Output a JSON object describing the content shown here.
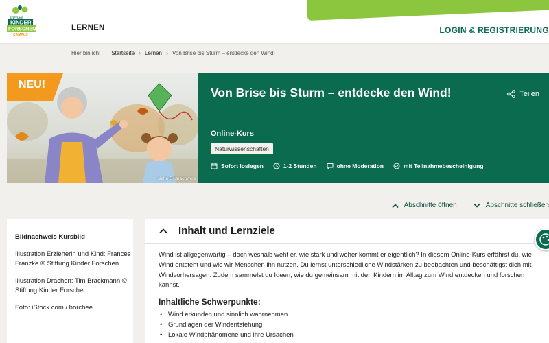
{
  "header": {
    "logo_lines": [
      "STIFTUNG",
      "KINDER",
      "FORSCHEN",
      "CAMPUS"
    ],
    "nav_label": "LERNEN",
    "login_label": "LOGIN & REGISTRIERUNG"
  },
  "breadcrumb": {
    "here": "Hier bin ich:",
    "items": [
      "Startseite",
      "Lernen",
      "Von Brise bis Sturm – entdecke den Wind!"
    ]
  },
  "hero": {
    "badge": "NEU!",
    "title": "Von Brise bis Sturm – entdecke den Wind!",
    "share_label": "Teilen",
    "type": "Online-Kurs",
    "tag": "Naturwissenschaften",
    "meta": [
      {
        "icon": "calendar-icon",
        "label": "Sofort loslegen"
      },
      {
        "icon": "clock-icon",
        "label": "1-2 Stunden"
      },
      {
        "icon": "speech-bubble-icon",
        "label": "ohne Moderation"
      },
      {
        "icon": "certificate-icon",
        "label": "mit Teilnahmebescheinigung"
      }
    ],
    "image_credit_link": "siehe Bildnachweis"
  },
  "toggles": {
    "open_label": "Abschnitte öffnen",
    "close_label": "Abschnitte schließen"
  },
  "sidebar": {
    "title": "Bildnachweis Kursbild",
    "paragraphs": [
      "Illustration Erzieherin und Kind: Frances Franzke © Stiftung Kinder Forschen",
      "Illustration Drachen: Tim Brackmann © Stiftung Kinder Forschen",
      "Foto: iStock.com / borchee"
    ]
  },
  "main": {
    "section_title": "Inhalt und Lernziele",
    "intro": "Wind ist allgegenwärtig – doch weshalb weht er, wie stark und woher kommt er eigentlich? In diesem Online-Kurs erfährst du, wie Wind entsteht und wie wir Menschen ihn nutzen. Du lernst unterschiedliche Windstärken zu beobachten und beschäftigst dich mit Windvorhersagen. Zudem sammelst du Ideen, wie du gemeinsam mit den Kindern im Alltag zum Wind entdecken und forschen kannst.",
    "subheading": "Inhaltliche Schwerpunkte:",
    "bullets": [
      "Wind erkunden und sinnlich wahrnehmen",
      "Grundlagen der Windentstehung",
      "Lokale Windphänomene und ihre Ursachen"
    ]
  },
  "colors": {
    "brand_green": "#0b6b4f",
    "accent_lime": "#8cc63f",
    "badge_orange": "#f39a1e",
    "page_bg": "#f2f0ed"
  }
}
